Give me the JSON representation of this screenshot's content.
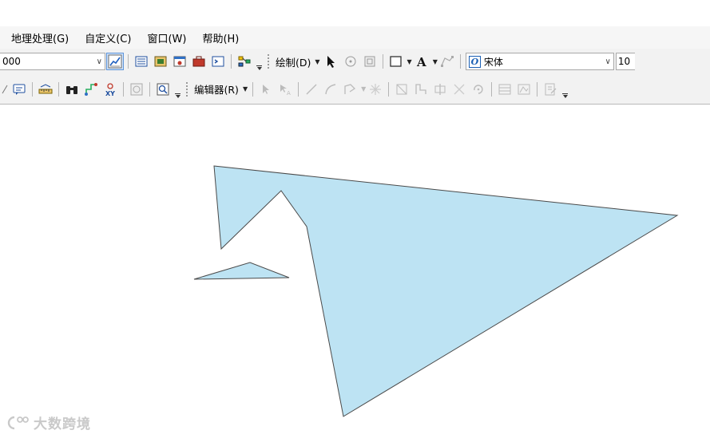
{
  "menu": [
    {
      "label": "地理处理(G)"
    },
    {
      "label": "自定义(C)"
    },
    {
      "label": "窗口(W)"
    },
    {
      "label": "帮助(H)"
    }
  ],
  "toolbar1": {
    "scale_value": "000",
    "draw_label": "绘制(D)",
    "font_badge": "O",
    "font_name": "宋体",
    "font_size": "10"
  },
  "toolbar2": {
    "editor_label": "编辑器(R)"
  },
  "watermark": {
    "text": "大数跨境"
  },
  "colors": {
    "polygon_fill": "#bde3f3",
    "polygon_stroke": "#4a4a4a",
    "active_tool": "#cfe3fb"
  }
}
